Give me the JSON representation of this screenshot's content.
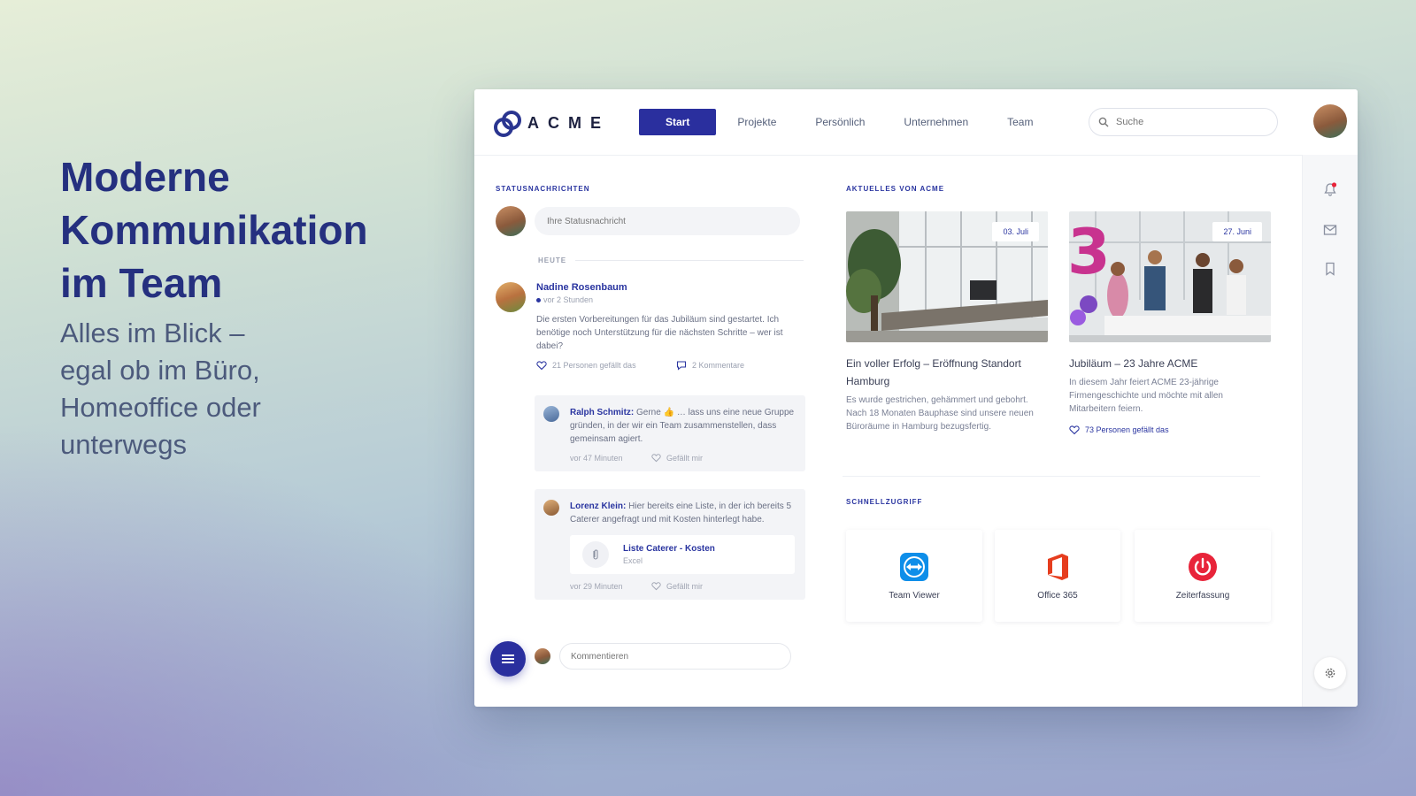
{
  "hero": {
    "title": "Moderne\nKommunikation\nim Team",
    "subtitle": "Alles im Blick –\negal ob im Büro,\nHomeoffice oder\nunterwegs"
  },
  "app": {
    "brand": "ACME",
    "nav": [
      "Start",
      "Projekte",
      "Persönlich",
      "Unternehmen",
      "Team"
    ],
    "active_nav": "Start",
    "search_placeholder": "Suche",
    "status_section": "STATUSNACHRICHTEN",
    "status_placeholder": "Ihre Statusnachricht",
    "today_label": "HEUTE",
    "post": {
      "author": "Nadine Rosenbaum",
      "time": "vor 2 Stunden",
      "text": "Die ersten Vorbereitungen für das Jubiläum sind gestartet. Ich benötige noch Unterstützung für die nächsten Schritte – wer ist dabei?",
      "likes": "21 Personen gefällt das",
      "comments": "2 Kommentare"
    },
    "comments": [
      {
        "name": "Ralph Schmitz:",
        "text": "Gerne 👍 … lass uns eine neue Gruppe gründen, in der wir ein Team zusammenstellen, dass gemeinsam agiert.",
        "time": "vor 47 Minuten",
        "like": "Gefällt mir"
      },
      {
        "name": "Lorenz Klein:",
        "text": "Hier bereits eine Liste, in der ich bereits 5 Caterer angefragt und mit Kosten hinterlegt habe.",
        "time": "vor 29 Minuten",
        "like": "Gefällt mir",
        "attachment_title": "Liste Caterer - Kosten",
        "attachment_type": "Excel"
      }
    ],
    "comment_placeholder": "Kommentieren",
    "news_section": "AKTUELLES VON ACME",
    "news": [
      {
        "date": "03. Juli",
        "title": "Ein voller Erfolg – Eröffnung Standort Hamburg",
        "text": "Es wurde gestrichen, gehämmert und gebohrt. Nach 18 Monaten Bauphase sind unsere neuen Büroräume in Hamburg bezugsfertig."
      },
      {
        "date": "27. Juni",
        "title": "Jubiläum – 23 Jahre ACME",
        "text": "In diesem Jahr feiert ACME 23-jährige Firmengeschichte und möchte mit allen Mitarbeitern feiern.",
        "likes": "73 Personen gefällt das"
      }
    ],
    "quick_section": "SCHNELLZUGRIFF",
    "quick": [
      {
        "label": "Team Viewer",
        "icon": "teamviewer-icon"
      },
      {
        "label": "Office 365",
        "icon": "office-icon"
      },
      {
        "label": "Zeiterfassung",
        "icon": "power-icon"
      }
    ],
    "colors": {
      "primary": "#2a2f9e",
      "hero_text": "#25307f",
      "office_red": "#e63d1e",
      "teamviewer_blue": "#0e8ee9",
      "power_red": "#e8243a"
    }
  }
}
